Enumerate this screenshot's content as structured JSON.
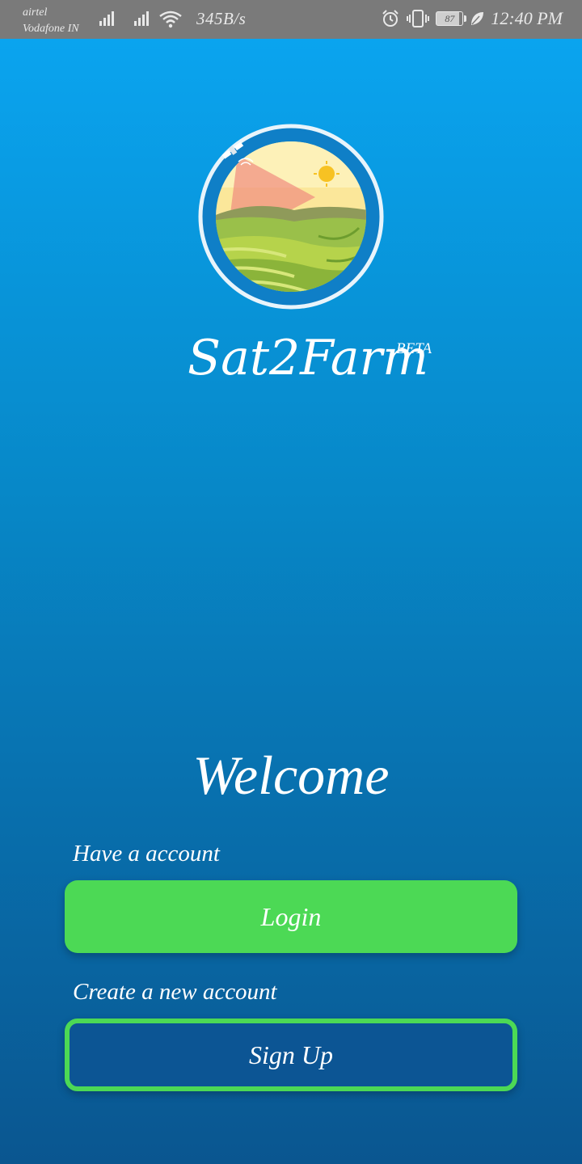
{
  "status_bar": {
    "carrier_1": "airtel",
    "carrier_2": "Vodafone IN",
    "net_speed": "345B/s",
    "battery": "87",
    "time": "12:40 PM",
    "icons": [
      "signal-icon",
      "signal-icon",
      "wifi-icon",
      "alarm-icon",
      "vibrate-icon",
      "battery-icon",
      "leaf-icon"
    ]
  },
  "app": {
    "name": "Sat2Farm",
    "badge": "BETA"
  },
  "welcome": {
    "heading": "Welcome",
    "login_caption": "Have a account",
    "login_label": "Login",
    "signup_caption": "Create a new account",
    "signup_label": "Sign Up"
  },
  "colors": {
    "accent_green": "#4cd955",
    "signup_blue": "#0c5594",
    "gradient_top": "#0aa4ef",
    "gradient_bottom": "#0a5690"
  }
}
